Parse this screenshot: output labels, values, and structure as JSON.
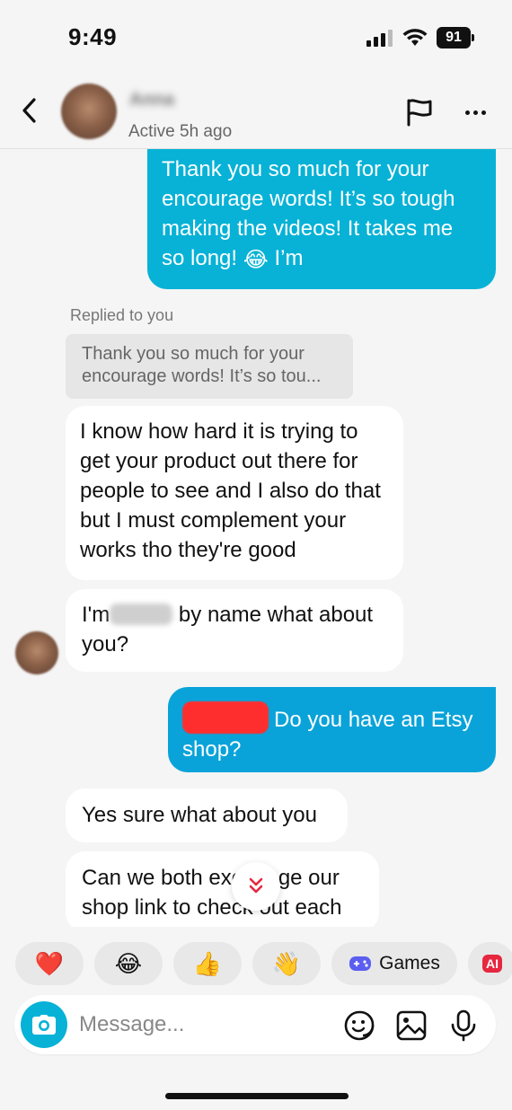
{
  "status_bar": {
    "time": "9:49",
    "battery": "91"
  },
  "header": {
    "contact_name": "Anna",
    "contact_status": "Active 5h ago"
  },
  "messages": [
    {
      "direction": "sent",
      "text_before_emoji": "Thank you so much for your encourage words! It’s so tough making the videos! It takes me so long!",
      "emoji": "😂",
      "text_after_emoji": "I’m"
    },
    {
      "direction": "received",
      "reply_label": "Replied to you",
      "quoted_text": "Thank you so much for your encourage words! It’s so tou...",
      "text": "I know how hard it is trying to get your product out there for people to see and I also do that but I must complement your works tho they're good"
    },
    {
      "direction": "received",
      "text_before_name": "I'm",
      "redacted_name": "Anna",
      "text_after_name": "by name what about you?"
    },
    {
      "direction": "sent",
      "text": "Do you have an Etsy shop?"
    },
    {
      "direction": "received",
      "text": "Yes sure what about you"
    },
    {
      "direction": "received",
      "text": "Can we both exchange our shop link to check out each"
    }
  ],
  "reactions": [
    "❤️",
    "😂",
    "👍",
    "👋"
  ],
  "games_label": "Games",
  "ai_label": "AI",
  "composer": {
    "placeholder": "Message..."
  },
  "colors": {
    "sent_bubble": "#07b2d6",
    "sent_bubble_2": "#0aa3d9",
    "background": "#f5f5f5"
  }
}
